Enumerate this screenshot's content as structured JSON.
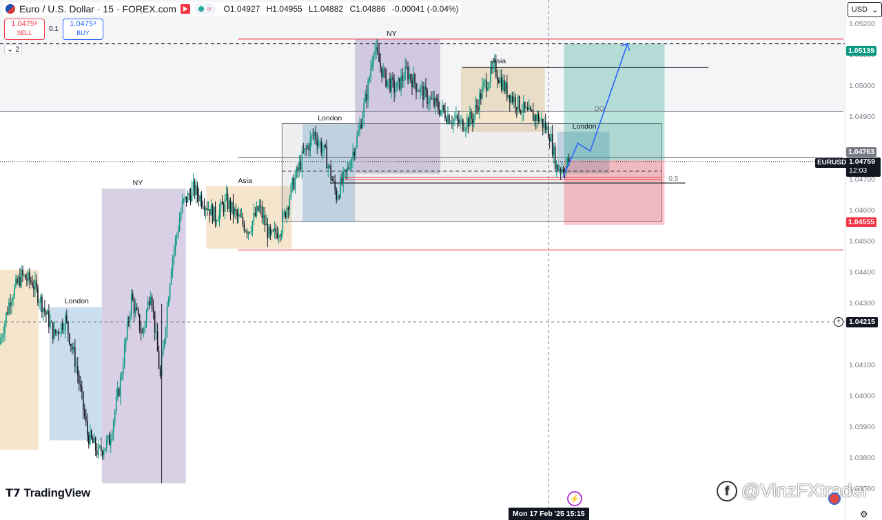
{
  "header": {
    "symbol_title": "Euro / U.S. Dollar · 15 · FOREX.com",
    "ohlc": {
      "o_label": "O",
      "o": "1.04927",
      "h_label": "H",
      "h": "1.04955",
      "l_label": "L",
      "l": "1.04882",
      "c_label": "C",
      "c": "1.04886",
      "change": "-0.00041 (-0.04%)"
    }
  },
  "trade": {
    "sell_price": "1.0475⁸",
    "sell_label": "SELL",
    "spread": "0.1",
    "buy_price": "1.0475⁹",
    "buy_label": "BUY"
  },
  "layers_label": "2",
  "currency_button": "USD",
  "price_axis_labels": [
    "1.05200",
    "1.05100",
    "1.05000",
    "1.04900",
    "1.04700",
    "1.04600",
    "1.04500",
    "1.04400",
    "1.04300",
    "1.04100",
    "1.04000",
    "1.03900",
    "1.03800",
    "1.03700"
  ],
  "price_tags": {
    "tp": {
      "value": "1.05139",
      "color": "#089981"
    },
    "level": {
      "value": "1.04763",
      "color": "#787b86"
    },
    "current": {
      "value": "1.04759",
      "timer": "12:03",
      "color": "#131722"
    },
    "sl": {
      "value": "1.04555",
      "color": "#f23645"
    },
    "crosshair": {
      "value": "1.04215"
    }
  },
  "symbol_tag": "EURUSD",
  "crosshair_time": "Mon 17 Feb '25   15:15",
  "brand": "TradingView",
  "watermark": "@VinzFXtrader",
  "chart_data": {
    "type": "candlestick",
    "instrument": "EURUSD",
    "timeframe": "15",
    "ylim": [
      1.0365,
      1.0528
    ],
    "colors": {
      "up": "#089981",
      "down": "#131722",
      "tp_zone": "#089981",
      "sl_zone": "#f23645"
    },
    "session_boxes": [
      {
        "label": "",
        "kind": "asia",
        "t0": 0,
        "t1": 28,
        "low": 1.0383,
        "high": 1.0441
      },
      {
        "label": "London",
        "kind": "london",
        "t0": 36,
        "t1": 74,
        "low": 1.0386,
        "high": 1.0429
      },
      {
        "label": "NY",
        "kind": "ny",
        "t0": 74,
        "t1": 135,
        "low": 1.03722,
        "high": 1.04672
      },
      {
        "label": "Asia",
        "kind": "asia",
        "t0": 150,
        "t1": 212,
        "low": 1.04478,
        "high": 1.0468
      },
      {
        "label": "London",
        "kind": "london",
        "t0": 220,
        "t1": 258,
        "low": 1.04565,
        "high": 1.0488
      },
      {
        "label": "NY",
        "kind": "ny",
        "t0": 258,
        "t1": 320,
        "low": 1.0472,
        "high": 1.05154
      },
      {
        "label": "Asia",
        "kind": "asia",
        "t0": 335,
        "t1": 396,
        "low": 1.04855,
        "high": 1.05065
      },
      {
        "label": "London",
        "kind": "london",
        "t0": 405,
        "t1": 443,
        "low": 1.0472,
        "high": 1.04855
      }
    ],
    "range_box": {
      "t0": 205,
      "t1": 481,
      "low": 1.04565,
      "high": 1.04882
    },
    "position": {
      "t0": 410,
      "t1": 483,
      "entry": 1.04763,
      "tp": 1.05139,
      "sl": 1.04555
    },
    "horizontal_lines": [
      {
        "price": 1.05154,
        "color": "#f23645",
        "t0": 173,
        "t1": 613
      },
      {
        "price": 1.0492,
        "color": "#787b86",
        "t0": 0,
        "t1": 613
      },
      {
        "price": 1.04773,
        "color": "#787b86",
        "t0": 173,
        "t1": 613
      },
      {
        "price": 1.04474,
        "color": "#f23645",
        "t0": 173,
        "t1": 613
      },
      {
        "price": 1.05062,
        "color": "#131722",
        "t0": 336,
        "t1": 515
      },
      {
        "price": 1.0469,
        "color": "#131722",
        "t0": 240,
        "t1": 498
      }
    ],
    "annotations": [
      {
        "text": "DO",
        "t": 432,
        "price": 1.04925
      },
      {
        "text": "0.5",
        "t": 486,
        "price": 1.04698
      }
    ],
    "projection_path": [
      [
        409,
        1.04707
      ],
      [
        420,
        1.04818
      ],
      [
        429,
        1.04793
      ],
      [
        456,
        1.05139
      ]
    ],
    "segments": [
      {
        "t": 0,
        "price": 1.0417
      },
      {
        "t": 8,
        "price": 1.0432
      },
      {
        "t": 16,
        "price": 1.0439
      },
      {
        "t": 24,
        "price": 1.0437
      },
      {
        "t": 32,
        "price": 1.0429
      },
      {
        "t": 40,
        "price": 1.042
      },
      {
        "t": 48,
        "price": 1.0425
      },
      {
        "t": 56,
        "price": 1.041
      },
      {
        "t": 64,
        "price": 1.0388
      },
      {
        "t": 72,
        "price": 1.0382
      },
      {
        "t": 80,
        "price": 1.0386
      },
      {
        "t": 88,
        "price": 1.0405
      },
      {
        "t": 96,
        "price": 1.0432
      },
      {
        "t": 104,
        "price": 1.042
      },
      {
        "t": 110,
        "price": 1.0435
      },
      {
        "t": 117,
        "price": 1.0406
      },
      {
        "t": 125,
        "price": 1.0443
      },
      {
        "t": 133,
        "price": 1.0462
      },
      {
        "t": 141,
        "price": 1.0467
      },
      {
        "t": 149,
        "price": 1.0463
      },
      {
        "t": 157,
        "price": 1.0458
      },
      {
        "t": 165,
        "price": 1.0463
      },
      {
        "t": 173,
        "price": 1.0458
      },
      {
        "t": 181,
        "price": 1.0454
      },
      {
        "t": 189,
        "price": 1.0461
      },
      {
        "t": 197,
        "price": 1.0451
      },
      {
        "t": 205,
        "price": 1.0455
      },
      {
        "t": 213,
        "price": 1.0468
      },
      {
        "t": 221,
        "price": 1.0478
      },
      {
        "t": 229,
        "price": 1.0485
      },
      {
        "t": 237,
        "price": 1.0478
      },
      {
        "t": 245,
        "price": 1.0465
      },
      {
        "t": 253,
        "price": 1.0473
      },
      {
        "t": 261,
        "price": 1.0485
      },
      {
        "t": 268,
        "price": 1.05
      },
      {
        "t": 272,
        "price": 1.0513
      },
      {
        "t": 280,
        "price": 1.0503
      },
      {
        "t": 288,
        "price": 1.0499
      },
      {
        "t": 296,
        "price": 1.0505
      },
      {
        "t": 304,
        "price": 1.05
      },
      {
        "t": 312,
        "price": 1.0496
      },
      {
        "t": 320,
        "price": 1.0493
      },
      {
        "t": 328,
        "price": 1.049
      },
      {
        "t": 336,
        "price": 1.0488
      },
      {
        "t": 344,
        "price": 1.049
      },
      {
        "t": 352,
        "price": 1.05
      },
      {
        "t": 360,
        "price": 1.0506
      },
      {
        "t": 368,
        "price": 1.0499
      },
      {
        "t": 376,
        "price": 1.0495
      },
      {
        "t": 384,
        "price": 1.0491
      },
      {
        "t": 392,
        "price": 1.049
      },
      {
        "t": 400,
        "price": 1.0485
      },
      {
        "t": 405,
        "price": 1.0474
      },
      {
        "t": 410,
        "price": 1.0474
      },
      {
        "t": 414,
        "price": 1.0476
      }
    ]
  }
}
